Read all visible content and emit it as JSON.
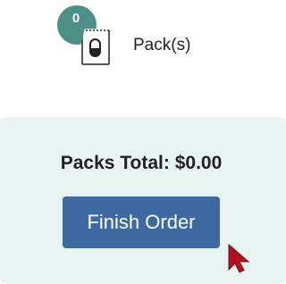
{
  "pack": {
    "count": "0",
    "label": "Pack(s)",
    "icon": "pill-pack-icon"
  },
  "totals": {
    "title": "Packs Total: $0.00"
  },
  "actions": {
    "finish_label": "Finish Order"
  },
  "colors": {
    "badge": "#4b8f86",
    "panel_bg": "#e9f3f2",
    "button_bg": "#3d6aa1",
    "cursor": "#b3101f"
  }
}
